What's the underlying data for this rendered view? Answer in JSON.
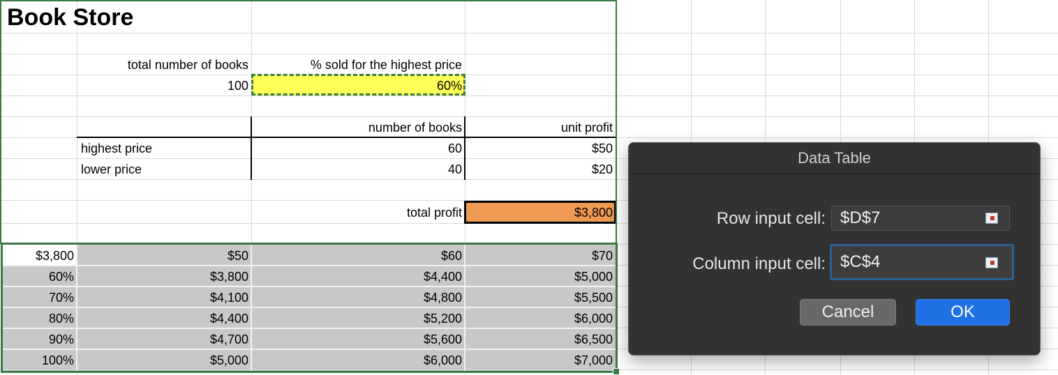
{
  "sheet": {
    "title": "Book Store",
    "labels": {
      "total_books": "total number of books",
      "pct_sold": "% sold for the highest price",
      "number_of_books": "number of books",
      "unit_profit": "unit profit",
      "highest_price": "highest price",
      "lower_price": "lower price",
      "total_profit": "total profit"
    },
    "values": {
      "total_books": "100",
      "pct_sold": "60%",
      "highest_books": "60",
      "lower_books": "40",
      "highest_profit": "$50",
      "lower_profit": "$20",
      "total_profit": "$3,800"
    },
    "table": {
      "corner": "$3,800",
      "col_headers": [
        "$50",
        "$60",
        "$70"
      ],
      "rows": [
        {
          "pct": "60%",
          "cells": [
            "$3,800",
            "$4,400",
            "$5,000"
          ]
        },
        {
          "pct": "70%",
          "cells": [
            "$4,100",
            "$4,800",
            "$5,500"
          ]
        },
        {
          "pct": "80%",
          "cells": [
            "$4,400",
            "$5,200",
            "$6,000"
          ]
        },
        {
          "pct": "90%",
          "cells": [
            "$4,700",
            "$5,600",
            "$6,500"
          ]
        },
        {
          "pct": "100%",
          "cells": [
            "$5,000",
            "$6,000",
            "$7,000"
          ]
        }
      ]
    },
    "colors": {
      "input_highlight": "#ffff57",
      "profit_highlight": "#ef9a52",
      "selection": "#c8c8c8",
      "selection_border": "#3a7a44"
    }
  },
  "dialog": {
    "title": "Data Table",
    "row_input_label": "Row input cell:",
    "row_input_value": "$D$7",
    "column_input_label": "Column input cell:",
    "column_input_value": "$C$4",
    "cancel_label": "Cancel",
    "ok_label": "OK",
    "picker_icon": "range-picker-icon"
  }
}
